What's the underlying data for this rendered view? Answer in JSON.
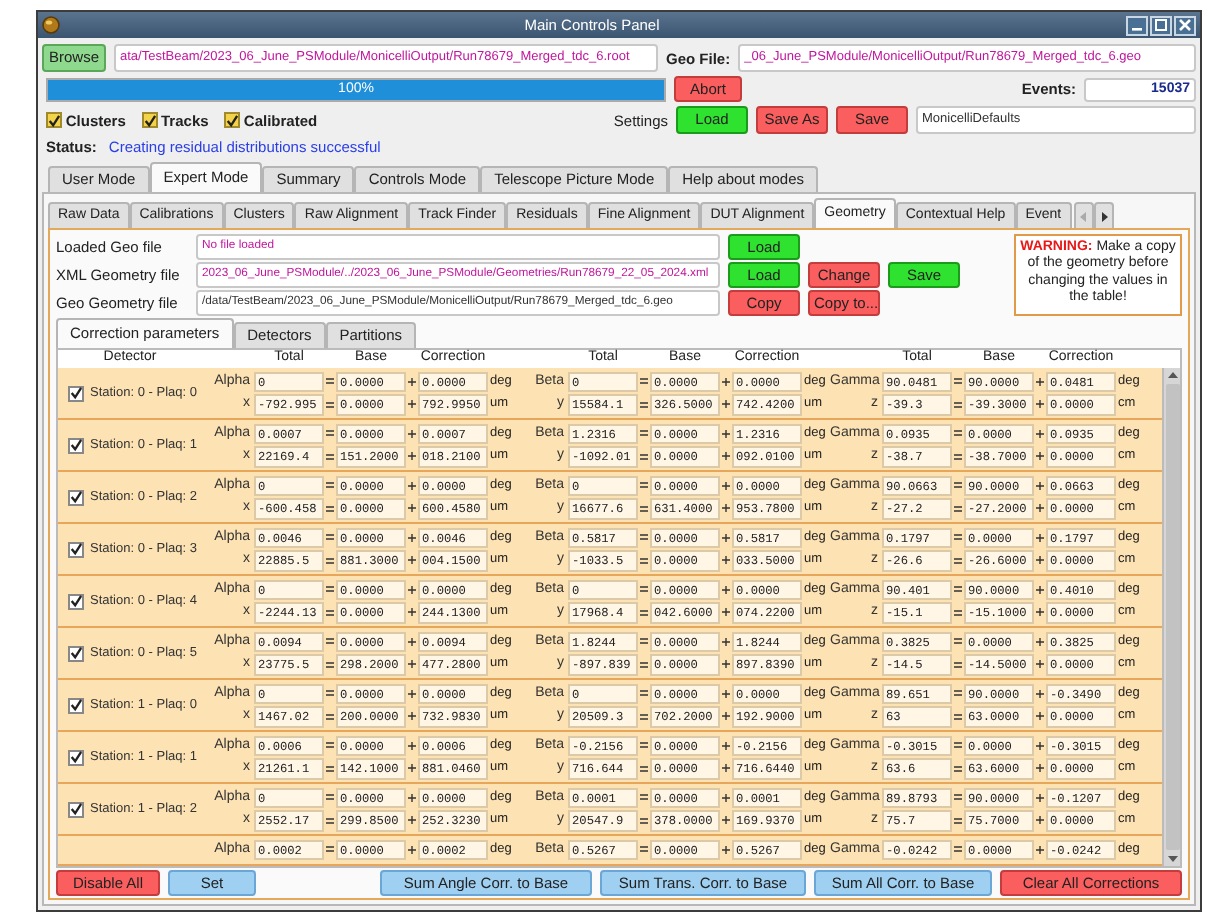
{
  "window": {
    "title": "Main Controls Panel"
  },
  "file_bar": {
    "browse": "Browse",
    "path": "ata/TestBeam/2023_06_June_PSModule/MonicelliOutput/Run78679_Merged_tdc_6.root",
    "geo_label": "Geo File:",
    "geo_path": "_06_June_PSModule/MonicelliOutput/Run78679_Merged_tdc_6.geo"
  },
  "progress": {
    "level": 1,
    "text": "100%",
    "abort": "Abort",
    "events_label": "Events:",
    "events": "15037"
  },
  "options": [
    {
      "label": "Clusters",
      "checked": true
    },
    {
      "label": "Tracks",
      "checked": true
    },
    {
      "label": "Calibrated",
      "checked": true
    }
  ],
  "settings": {
    "label": "Settings",
    "buttons": [
      {
        "label": "Load",
        "kind": "go"
      },
      {
        "label": "Save As",
        "kind": "stop"
      },
      {
        "label": "Save",
        "kind": "stop"
      }
    ],
    "name": "MonicelliDefaults"
  },
  "status": {
    "label": "Status:",
    "text": "Creating residual distributions successful"
  },
  "mode_tabs": [
    {
      "label": "User Mode",
      "selected": false
    },
    {
      "label": "Expert Mode",
      "selected": true
    },
    {
      "label": "Summary",
      "selected": false
    },
    {
      "label": "Controls Mode",
      "selected": false
    },
    {
      "label": "Telescope Picture Mode",
      "selected": false
    },
    {
      "label": "Help about modes",
      "selected": false
    }
  ],
  "view_tabs": [
    {
      "label": "Raw Data",
      "selected": false
    },
    {
      "label": "Calibrations",
      "selected": false
    },
    {
      "label": "Clusters",
      "selected": false
    },
    {
      "label": "Raw Alignment",
      "selected": false
    },
    {
      "label": "Track Finder",
      "selected": false
    },
    {
      "label": "Residuals",
      "selected": false
    },
    {
      "label": "Fine Alignment",
      "selected": false
    },
    {
      "label": "DUT Alignment",
      "selected": false
    },
    {
      "label": "Geometry",
      "selected": true
    },
    {
      "label": "Contextual Help",
      "selected": false
    },
    {
      "label": "Event",
      "selected": false
    }
  ],
  "geometry_files": [
    {
      "label": "Loaded Geo file",
      "value": "No file loaded",
      "emphasis": true,
      "buttons": [
        {
          "label": "Load",
          "kind": "go"
        }
      ]
    },
    {
      "label": "XML Geometry file",
      "value": "2023_06_June_PSModule/../2023_06_June_PSModule/Geometries/Run78679_22_05_2024.xml",
      "emphasis": true,
      "buttons": [
        {
          "label": "Load",
          "kind": "go"
        },
        {
          "label": "Change",
          "kind": "stop"
        },
        {
          "label": "Save",
          "kind": "go"
        }
      ]
    },
    {
      "label": "Geo Geometry file",
      "value": "/data/TestBeam/2023_06_June_PSModule/MonicelliOutput/Run78679_Merged_tdc_6.geo",
      "emphasis": false,
      "buttons": [
        {
          "label": "Copy",
          "kind": "stop"
        },
        {
          "label": "Copy to...",
          "kind": "stop"
        }
      ]
    }
  ],
  "warning": {
    "label": "WARNING:",
    "text": "Make a copy of the geometry before changing the values in the table!"
  },
  "geometry_tabs": [
    {
      "label": "Correction parameters",
      "selected": true
    },
    {
      "label": "Detectors",
      "selected": false
    },
    {
      "label": "Partitions",
      "selected": false
    }
  ],
  "table": {
    "columns": [
      "Detector",
      "Total",
      "Base",
      "Correction",
      "Total",
      "Base",
      "Correction",
      "Total",
      "Base",
      "Correction"
    ],
    "rows": [
      {
        "detector": "Station: 0 - Plaq: 0",
        "checked": true,
        "lines": [
          [
            {
              "label": "Alpha",
              "total": "0",
              "base": "0.0000",
              "correction": "0.0000",
              "unit": "deg"
            },
            {
              "label": "Beta",
              "total": "0",
              "base": "0.0000",
              "correction": "0.0000",
              "unit": "deg"
            },
            {
              "label": "Gamma",
              "total": "90.0481",
              "base": "90.0000",
              "correction": "0.0481",
              "unit": "deg"
            }
          ],
          [
            {
              "label": "x",
              "total": "-792.995",
              "base": "0.0000",
              "correction": "792.9950",
              "unit": "um"
            },
            {
              "label": "y",
              "total": "15584.1",
              "base": "326.5000",
              "correction": "742.4200",
              "unit": "um"
            },
            {
              "label": "z",
              "total": "-39.3",
              "base": "-39.3000",
              "correction": "0.0000",
              "unit": "cm"
            }
          ]
        ]
      },
      {
        "detector": "Station: 0 - Plaq: 1",
        "checked": true,
        "lines": [
          [
            {
              "label": "Alpha",
              "total": "0.0007",
              "base": "0.0000",
              "correction": "0.0007",
              "unit": "deg"
            },
            {
              "label": "Beta",
              "total": "1.2316",
              "base": "0.0000",
              "correction": "1.2316",
              "unit": "deg"
            },
            {
              "label": "Gamma",
              "total": "0.0935",
              "base": "0.0000",
              "correction": "0.0935",
              "unit": "deg"
            }
          ],
          [
            {
              "label": "x",
              "total": "22169.4",
              "base": "151.2000",
              "correction": "018.2100",
              "unit": "um"
            },
            {
              "label": "y",
              "total": "-1092.01",
              "base": "0.0000",
              "correction": "092.0100",
              "unit": "um"
            },
            {
              "label": "z",
              "total": "-38.7",
              "base": "-38.7000",
              "correction": "0.0000",
              "unit": "cm"
            }
          ]
        ]
      },
      {
        "detector": "Station: 0 - Plaq: 2",
        "checked": true,
        "lines": [
          [
            {
              "label": "Alpha",
              "total": "0",
              "base": "0.0000",
              "correction": "0.0000",
              "unit": "deg"
            },
            {
              "label": "Beta",
              "total": "0",
              "base": "0.0000",
              "correction": "0.0000",
              "unit": "deg"
            },
            {
              "label": "Gamma",
              "total": "90.0663",
              "base": "90.0000",
              "correction": "0.0663",
              "unit": "deg"
            }
          ],
          [
            {
              "label": "x",
              "total": "-600.458",
              "base": "0.0000",
              "correction": "600.4580",
              "unit": "um"
            },
            {
              "label": "y",
              "total": "16677.6",
              "base": "631.4000",
              "correction": "953.7800",
              "unit": "um"
            },
            {
              "label": "z",
              "total": "-27.2",
              "base": "-27.2000",
              "correction": "0.0000",
              "unit": "cm"
            }
          ]
        ]
      },
      {
        "detector": "Station: 0 - Plaq: 3",
        "checked": true,
        "lines": [
          [
            {
              "label": "Alpha",
              "total": "0.0046",
              "base": "0.0000",
              "correction": "0.0046",
              "unit": "deg"
            },
            {
              "label": "Beta",
              "total": "0.5817",
              "base": "0.0000",
              "correction": "0.5817",
              "unit": "deg"
            },
            {
              "label": "Gamma",
              "total": "0.1797",
              "base": "0.0000",
              "correction": "0.1797",
              "unit": "deg"
            }
          ],
          [
            {
              "label": "x",
              "total": "22885.5",
              "base": "881.3000",
              "correction": "004.1500",
              "unit": "um"
            },
            {
              "label": "y",
              "total": "-1033.5",
              "base": "0.0000",
              "correction": "033.5000",
              "unit": "um"
            },
            {
              "label": "z",
              "total": "-26.6",
              "base": "-26.6000",
              "correction": "0.0000",
              "unit": "cm"
            }
          ]
        ]
      },
      {
        "detector": "Station: 0 - Plaq: 4",
        "checked": true,
        "lines": [
          [
            {
              "label": "Alpha",
              "total": "0",
              "base": "0.0000",
              "correction": "0.0000",
              "unit": "deg"
            },
            {
              "label": "Beta",
              "total": "0",
              "base": "0.0000",
              "correction": "0.0000",
              "unit": "deg"
            },
            {
              "label": "Gamma",
              "total": "90.401",
              "base": "90.0000",
              "correction": "0.4010",
              "unit": "deg"
            }
          ],
          [
            {
              "label": "x",
              "total": "-2244.13",
              "base": "0.0000",
              "correction": "244.1300",
              "unit": "um"
            },
            {
              "label": "y",
              "total": "17968.4",
              "base": "042.6000",
              "correction": "074.2200",
              "unit": "um"
            },
            {
              "label": "z",
              "total": "-15.1",
              "base": "-15.1000",
              "correction": "0.0000",
              "unit": "cm"
            }
          ]
        ]
      },
      {
        "detector": "Station: 0 - Plaq: 5",
        "checked": true,
        "lines": [
          [
            {
              "label": "Alpha",
              "total": "0.0094",
              "base": "0.0000",
              "correction": "0.0094",
              "unit": "deg"
            },
            {
              "label": "Beta",
              "total": "1.8244",
              "base": "0.0000",
              "correction": "1.8244",
              "unit": "deg"
            },
            {
              "label": "Gamma",
              "total": "0.3825",
              "base": "0.0000",
              "correction": "0.3825",
              "unit": "deg"
            }
          ],
          [
            {
              "label": "x",
              "total": "23775.5",
              "base": "298.2000",
              "correction": "477.2800",
              "unit": "um"
            },
            {
              "label": "y",
              "total": "-897.839",
              "base": "0.0000",
              "correction": "897.8390",
              "unit": "um"
            },
            {
              "label": "z",
              "total": "-14.5",
              "base": "-14.5000",
              "correction": "0.0000",
              "unit": "cm"
            }
          ]
        ]
      },
      {
        "detector": "Station: 1 - Plaq: 0",
        "checked": true,
        "lines": [
          [
            {
              "label": "Alpha",
              "total": "0",
              "base": "0.0000",
              "correction": "0.0000",
              "unit": "deg"
            },
            {
              "label": "Beta",
              "total": "0",
              "base": "0.0000",
              "correction": "0.0000",
              "unit": "deg"
            },
            {
              "label": "Gamma",
              "total": "89.651",
              "base": "90.0000",
              "correction": "-0.3490",
              "unit": "deg"
            }
          ],
          [
            {
              "label": "x",
              "total": "1467.02",
              "base": "200.0000",
              "correction": "732.9830",
              "unit": "um"
            },
            {
              "label": "y",
              "total": "20509.3",
              "base": "702.2000",
              "correction": "192.9000",
              "unit": "um"
            },
            {
              "label": "z",
              "total": "63",
              "base": "63.0000",
              "correction": "0.0000",
              "unit": "cm"
            }
          ]
        ]
      },
      {
        "detector": "Station: 1 - Plaq: 1",
        "checked": true,
        "lines": [
          [
            {
              "label": "Alpha",
              "total": "0.0006",
              "base": "0.0000",
              "correction": "0.0006",
              "unit": "deg"
            },
            {
              "label": "Beta",
              "total": "-0.2156",
              "base": "0.0000",
              "correction": "-0.2156",
              "unit": "deg"
            },
            {
              "label": "Gamma",
              "total": "-0.3015",
              "base": "0.0000",
              "correction": "-0.3015",
              "unit": "deg"
            }
          ],
          [
            {
              "label": "x",
              "total": "21261.1",
              "base": "142.1000",
              "correction": "881.0460",
              "unit": "um"
            },
            {
              "label": "y",
              "total": "716.644",
              "base": "0.0000",
              "correction": "716.6440",
              "unit": "um"
            },
            {
              "label": "z",
              "total": "63.6",
              "base": "63.6000",
              "correction": "0.0000",
              "unit": "cm"
            }
          ]
        ]
      },
      {
        "detector": "Station: 1 - Plaq: 2",
        "checked": true,
        "lines": [
          [
            {
              "label": "Alpha",
              "total": "0",
              "base": "0.0000",
              "correction": "0.0000",
              "unit": "deg"
            },
            {
              "label": "Beta",
              "total": "0.0001",
              "base": "0.0000",
              "correction": "0.0001",
              "unit": "deg"
            },
            {
              "label": "Gamma",
              "total": "89.8793",
              "base": "90.0000",
              "correction": "-0.1207",
              "unit": "deg"
            }
          ],
          [
            {
              "label": "x",
              "total": "2552.17",
              "base": "299.8500",
              "correction": "252.3230",
              "unit": "um"
            },
            {
              "label": "y",
              "total": "20547.9",
              "base": "378.0000",
              "correction": "169.9370",
              "unit": "um"
            },
            {
              "label": "z",
              "total": "75.7",
              "base": "75.7000",
              "correction": "0.0000",
              "unit": "cm"
            }
          ]
        ]
      },
      {
        "lines": [
          [
            {
              "label": "Alpha",
              "total": "0.0002",
              "base": "0.0000",
              "correction": "0.0002",
              "unit": "deg"
            },
            {
              "label": "Beta",
              "total": "0.5267",
              "base": "0.0000",
              "correction": "0.5267",
              "unit": "deg"
            },
            {
              "label": "Gamma",
              "total": "-0.0242",
              "base": "0.0000",
              "correction": "-0.0242",
              "unit": "deg"
            }
          ]
        ]
      }
    ]
  },
  "actions": [
    {
      "label": "Disable All",
      "kind": "stop"
    },
    {
      "label": "Set",
      "kind": "act"
    },
    {
      "label": "Sum Angle Corr. to Base",
      "kind": "act"
    },
    {
      "label": "Sum Trans. Corr. to Base",
      "kind": "act"
    },
    {
      "label": "Sum All Corr. to Base",
      "kind": "act"
    },
    {
      "label": "Clear All Corrections",
      "kind": "stop"
    }
  ]
}
